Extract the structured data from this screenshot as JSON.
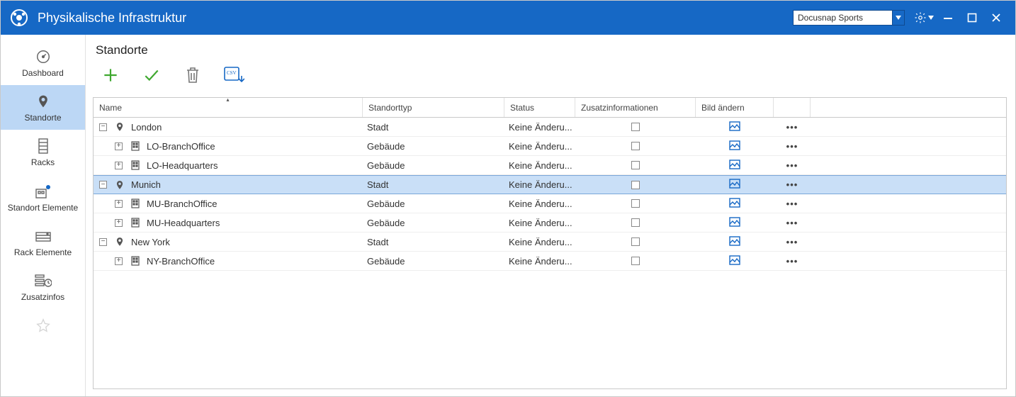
{
  "window": {
    "title": "Physikalische Infrastruktur",
    "tenant": "Docusnap Sports"
  },
  "sidebar": {
    "items": [
      {
        "label": "Dashboard"
      },
      {
        "label": "Standorte"
      },
      {
        "label": "Racks"
      },
      {
        "label": "Standort Elemente"
      },
      {
        "label": "Rack Elemente"
      },
      {
        "label": "Zusatzinfos"
      }
    ]
  },
  "page": {
    "title": "Standorte"
  },
  "grid": {
    "columns": {
      "name": "Name",
      "type": "Standorttyp",
      "status": "Status",
      "extra": "Zusatzinformationen",
      "image": "Bild ändern"
    },
    "rows": [
      {
        "level": 0,
        "expanded": true,
        "kind": "city",
        "name": "London",
        "type": "Stadt",
        "status": "Keine Änderu...",
        "selected": false
      },
      {
        "level": 1,
        "expanded": false,
        "kind": "building",
        "name": "LO-BranchOffice",
        "type": "Gebäude",
        "status": "Keine Änderu...",
        "selected": false
      },
      {
        "level": 1,
        "expanded": false,
        "kind": "building",
        "name": "LO-Headquarters",
        "type": "Gebäude",
        "status": "Keine Änderu...",
        "selected": false
      },
      {
        "level": 0,
        "expanded": true,
        "kind": "city",
        "name": "Munich",
        "type": "Stadt",
        "status": "Keine Änderu...",
        "selected": true
      },
      {
        "level": 1,
        "expanded": false,
        "kind": "building",
        "name": "MU-BranchOffice",
        "type": "Gebäude",
        "status": "Keine Änderu...",
        "selected": false
      },
      {
        "level": 1,
        "expanded": false,
        "kind": "building",
        "name": "MU-Headquarters",
        "type": "Gebäude",
        "status": "Keine Änderu...",
        "selected": false
      },
      {
        "level": 0,
        "expanded": true,
        "kind": "city",
        "name": "New York",
        "type": "Stadt",
        "status": "Keine Änderu...",
        "selected": false
      },
      {
        "level": 1,
        "expanded": false,
        "kind": "building",
        "name": "NY-BranchOffice",
        "type": "Gebäude",
        "status": "Keine Änderu...",
        "selected": false
      }
    ]
  }
}
